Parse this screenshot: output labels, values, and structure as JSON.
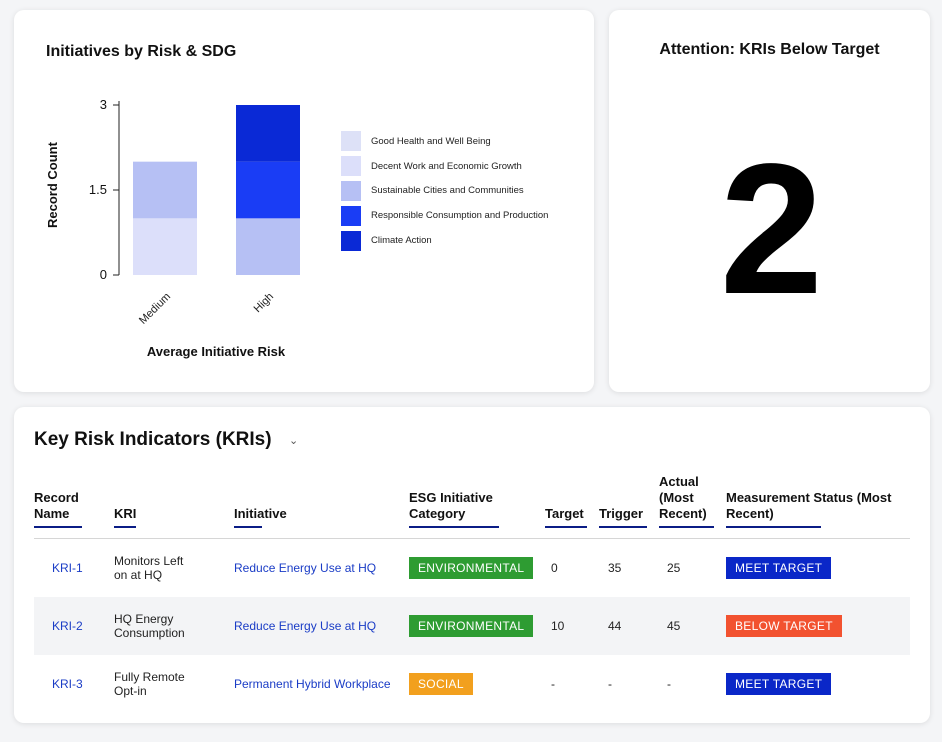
{
  "chart_panel": {
    "title": "Initiatives by Risk & SDG"
  },
  "chart_data": {
    "type": "bar",
    "stacked": true,
    "categories": [
      "Medium",
      "High"
    ],
    "series": [
      {
        "name": "Good Health and Well Being",
        "color": "#dde1f7",
        "values": [
          0,
          0
        ]
      },
      {
        "name": "Decent Work and Economic Growth",
        "color": "#dcdffa",
        "values": [
          1,
          0
        ]
      },
      {
        "name": "Sustainable Cities and Communities",
        "color": "#b6c0f4",
        "values": [
          1,
          1
        ]
      },
      {
        "name": "Responsible Consumption and Production",
        "color": "#1a3df5",
        "values": [
          0,
          1
        ]
      },
      {
        "name": "Climate Action",
        "color": "#0a29d6",
        "values": [
          0,
          1
        ]
      }
    ],
    "xlabel": "Average Initiative Risk",
    "ylabel": "Record Count",
    "yticks": [
      "3",
      "1.5",
      "0"
    ],
    "ylim": [
      0,
      3
    ],
    "legend_position": "right",
    "grid": false
  },
  "kpi": {
    "title": "Attention: KRIs Below Target",
    "value": "2"
  },
  "table": {
    "title": "Key Risk Indicators (KRIs)",
    "dropdown_icon": "chevron-down-icon",
    "dropdown_glyph": "⌄",
    "columns": [
      "Record Name",
      "KRI",
      "Initiative",
      "ESG Initiative Category",
      "Target",
      "Trigger",
      "Actual (Most Recent)",
      "Measurement Status (Most Recent)"
    ],
    "rows": [
      {
        "record": "KRI-1",
        "kri": "Monitors Left on at HQ",
        "initiative": "Reduce Energy Use at HQ",
        "category": "ENVIRONMENTAL",
        "category_color": "#2e9c32",
        "target": "0",
        "trigger": "35",
        "actual": "25",
        "status": "MEET TARGET",
        "status_color": "#0a27c8"
      },
      {
        "record": "KRI-2",
        "kri": "HQ Energy Consumption",
        "initiative": "Reduce Energy Use at HQ",
        "category": "ENVIRONMENTAL",
        "category_color": "#2e9c32",
        "target": "10",
        "trigger": "44",
        "actual": "45",
        "status": "BELOW TARGET",
        "status_color": "#f25230"
      },
      {
        "record": "KRI-3",
        "kri": "Fully Remote Opt-in",
        "initiative": "Permanent Hybrid Workplace",
        "category": "SOCIAL",
        "category_color": "#f2a01e",
        "target": "-",
        "trigger": "-",
        "actual": "-",
        "status": "MEET TARGET",
        "status_color": "#0a27c8"
      }
    ]
  }
}
